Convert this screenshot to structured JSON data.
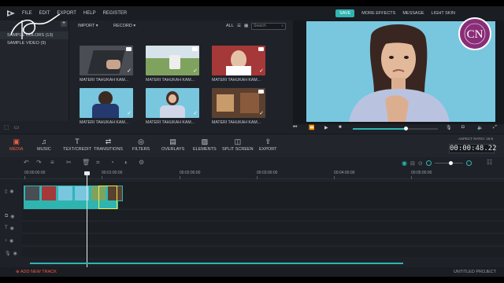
{
  "menu": {
    "items": [
      "FILE",
      "EDIT",
      "EXPORT",
      "HELP",
      "REGISTER"
    ],
    "save": "SAVE",
    "more_effects": "MORE EFFECTS",
    "message": "MESSAGE",
    "light_skin": "LIGHT SKIN"
  },
  "library": {
    "items": [
      {
        "label": "SAMPLE COLORS (13)"
      },
      {
        "label": "SAMPLE VIDEO (9)"
      }
    ]
  },
  "media": {
    "import": "IMPORT",
    "record": "RECORD",
    "filter_all": "ALL",
    "search_placeholder": "Search",
    "thumbs": [
      {
        "label": "MATERI TAHUKAH KAM...",
        "bg": "#5a5e64",
        "checked": true
      },
      {
        "label": "MATERI TAHUKAH KAM...",
        "bg": "#6f8a55",
        "checked": true
      },
      {
        "label": "MATERI TAHUKAH KAM...",
        "bg": "#a83535",
        "checked": true
      },
      {
        "label": "MATERI TAHUKAH KAM...",
        "bg": "#79c6df",
        "checked": true
      },
      {
        "label": "MATERI TAHUKAH KAM...",
        "bg": "#79c6df",
        "checked": true
      },
      {
        "label": "MATERI TAHUKAH KAM...",
        "bg": "#5b4030",
        "checked": true
      }
    ]
  },
  "tools": {
    "media": "MEDIA",
    "music": "MUSIC",
    "text": "TEXT/CREDIT",
    "transitions": "TRANSITIONS",
    "filters": "FILTERS",
    "overlays": "OVERLAYS",
    "elements": "ELEMENTS",
    "split_screen": "SPLIT SCREEN",
    "export": "EXPORT"
  },
  "aspect_ratio": "ASPECT RATIO: 16:9",
  "timecode": "00:00:48.22",
  "ruler": [
    "00:00:00:00",
    "00:01:00:00",
    "00:02:00:00",
    "00:03:00:00",
    "00:04:00:00",
    "00:05:00:00"
  ],
  "bottom": {
    "add_track": "ADD NEW TRACK",
    "project": "UNTITLED PROJECT"
  },
  "colors": {
    "accent": "#2fb5b0",
    "active_tool": "#f05c47",
    "watermark": "#8a2d78"
  }
}
